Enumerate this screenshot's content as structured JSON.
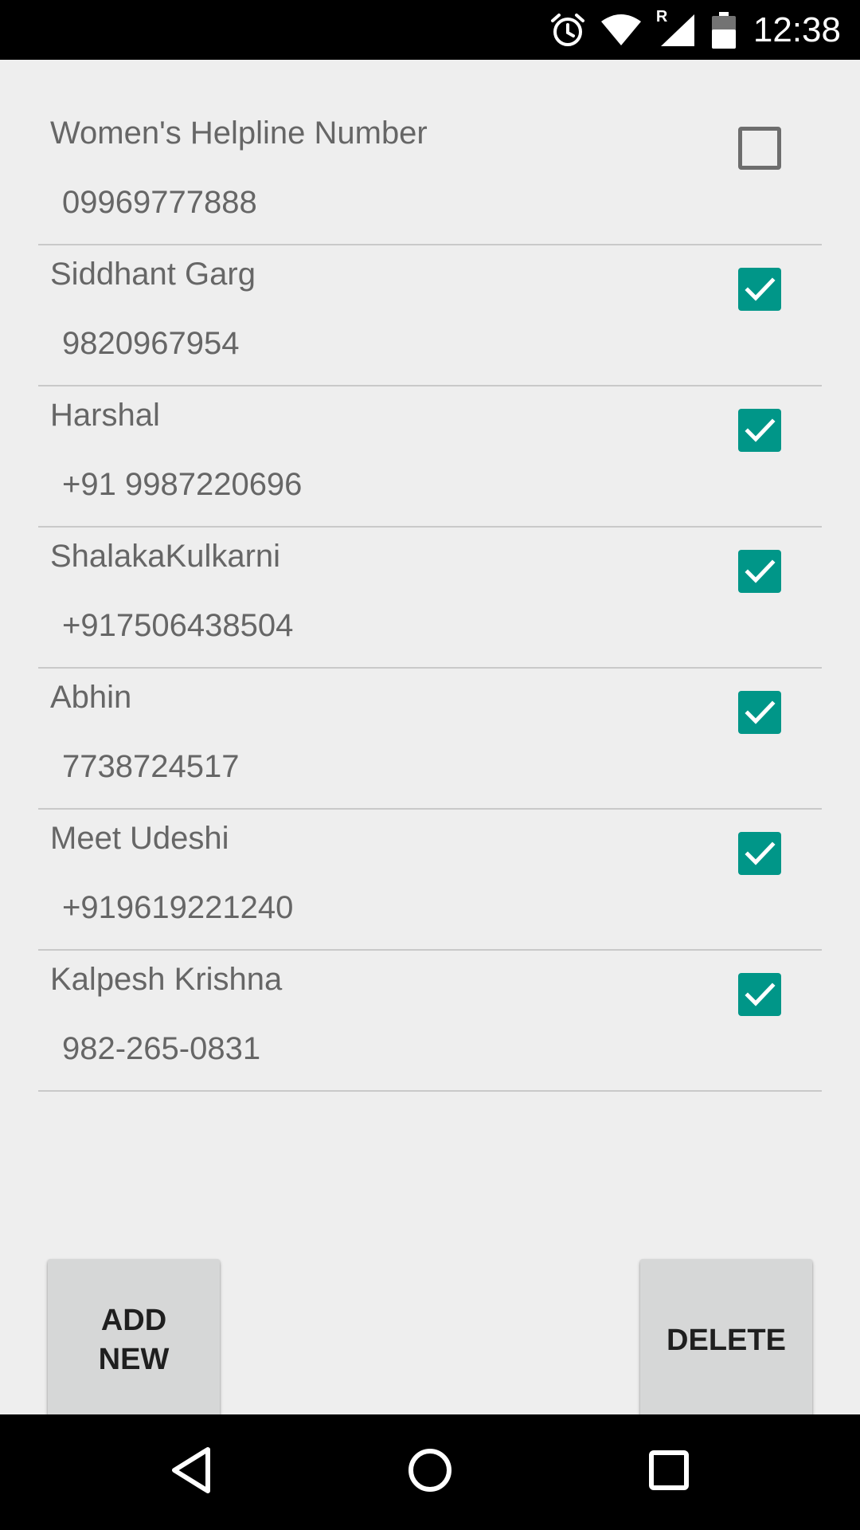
{
  "status_bar": {
    "time": "12:38",
    "icons": [
      "alarm-icon",
      "wifi-icon",
      "roaming-r-icon",
      "signal-icon",
      "battery-icon"
    ],
    "roaming_label": "R"
  },
  "contacts": [
    {
      "name": "Women's Helpline Number",
      "phone": "09969777888",
      "checked": false
    },
    {
      "name": "Siddhant Garg",
      "phone": "9820967954",
      "checked": true
    },
    {
      "name": "Harshal",
      "phone": "+91 9987220696",
      "checked": true
    },
    {
      "name": "ShalakaKulkarni",
      "phone": "+917506438504",
      "checked": true
    },
    {
      "name": "Abhin",
      "phone": "7738724517",
      "checked": true
    },
    {
      "name": "Meet Udeshi",
      "phone": "+919619221240",
      "checked": true
    },
    {
      "name": "Kalpesh Krishna",
      "phone": "982-265-0831",
      "checked": true
    }
  ],
  "buttons": {
    "add_new_label": "ADD\nNEW",
    "delete_label": "DELETE"
  },
  "nav_bar": {
    "icons": [
      "back-icon",
      "home-icon",
      "recents-icon"
    ]
  },
  "colors": {
    "accent": "#009688",
    "background": "#eeeeee",
    "button": "#d6d7d7",
    "text_secondary": "#666666",
    "divider": "#c9c9c9"
  }
}
